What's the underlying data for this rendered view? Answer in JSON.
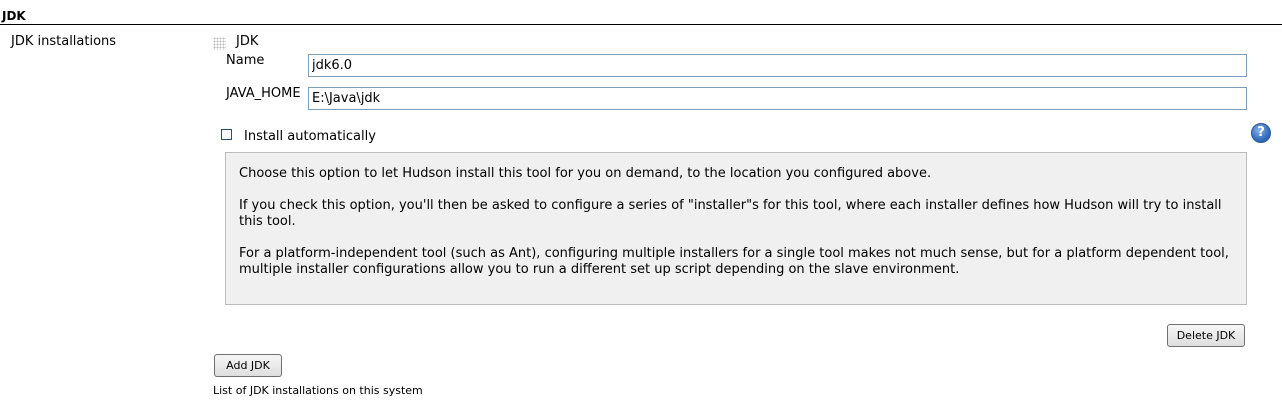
{
  "section": {
    "title": "JDK"
  },
  "row": {
    "label": "JDK installations"
  },
  "jdk_item": {
    "title": "JDK",
    "name_label": "Name",
    "name_value": "jdk6.0",
    "java_home_label": "JAVA_HOME",
    "java_home_value": "E:\\Java\\jdk",
    "install_auto_label": "Install automatically",
    "install_auto_checked": false,
    "help_icon_glyph": "?",
    "help_paragraphs": [
      "Choose this option to let Hudson install this tool for you on demand, to the location you configured above.",
      "If you check this option, you'll then be asked to configure a series of \"installer\"s for this tool, where each installer defines how Hudson will try to install this tool.",
      "For a platform-independent tool (such as Ant), configuring multiple installers for a single tool makes not much sense, but for a platform dependent tool, multiple installer configurations allow you to run a different set up script depending on the slave environment."
    ],
    "delete_label": "Delete JDK"
  },
  "add_label": "Add JDK",
  "list_caption": "List of JDK installations on this system",
  "icons": {
    "drag_handle": "drag-handle-icon",
    "help": "help-icon"
  },
  "colors": {
    "input_border": "#7f9db9",
    "help_box_bg": "#f0f0f0",
    "help_icon": "#3b72c0"
  }
}
